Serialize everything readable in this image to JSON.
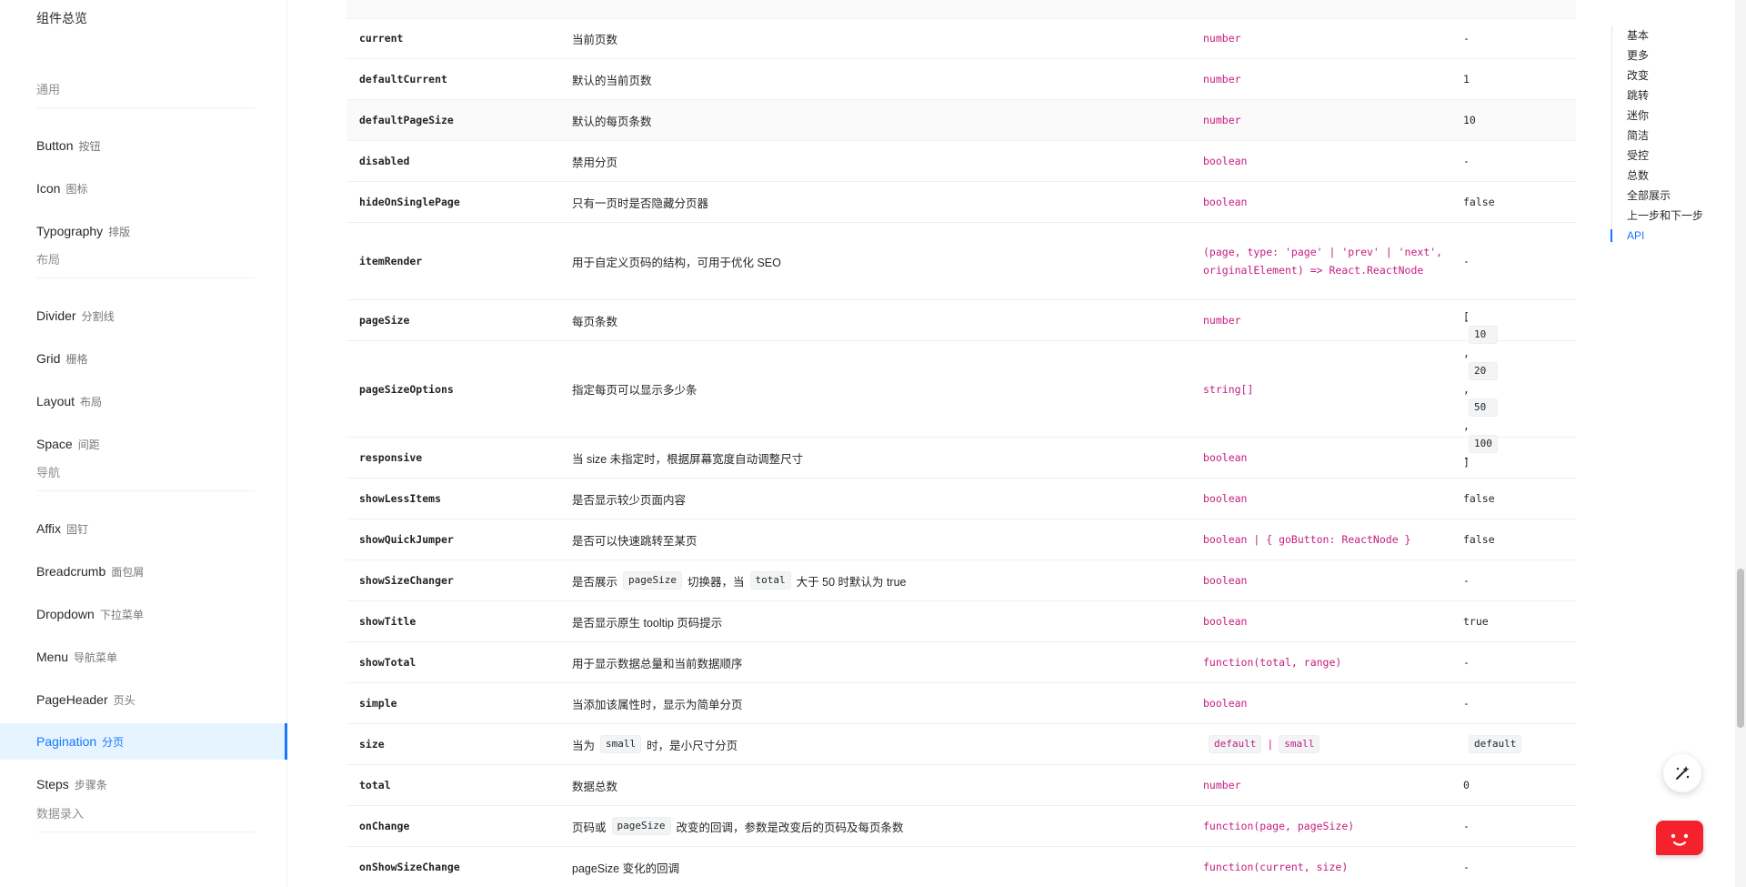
{
  "sidebar": {
    "top": "组件总览",
    "items": [
      {
        "type": "group",
        "label": "通用"
      },
      {
        "type": "item",
        "en": "Button",
        "zh": "按钮"
      },
      {
        "type": "item",
        "en": "Icon",
        "zh": "图标"
      },
      {
        "type": "item",
        "en": "Typography",
        "zh": "排版"
      },
      {
        "type": "group",
        "label": "布局"
      },
      {
        "type": "item",
        "en": "Divider",
        "zh": "分割线"
      },
      {
        "type": "item",
        "en": "Grid",
        "zh": "栅格"
      },
      {
        "type": "item",
        "en": "Layout",
        "zh": "布局"
      },
      {
        "type": "item",
        "en": "Space",
        "zh": "间距"
      },
      {
        "type": "group",
        "label": "导航"
      },
      {
        "type": "item",
        "en": "Affix",
        "zh": "固钉"
      },
      {
        "type": "item",
        "en": "Breadcrumb",
        "zh": "面包屑"
      },
      {
        "type": "item",
        "en": "Dropdown",
        "zh": "下拉菜单"
      },
      {
        "type": "item",
        "en": "Menu",
        "zh": "导航菜单"
      },
      {
        "type": "item",
        "en": "PageHeader",
        "zh": "页头"
      },
      {
        "type": "item",
        "en": "Pagination",
        "zh": "分页",
        "active": true
      },
      {
        "type": "item",
        "en": "Steps",
        "zh": "步骤条"
      },
      {
        "type": "group",
        "label": "数据录入"
      }
    ]
  },
  "table": {
    "rows": [
      {
        "prop": "current",
        "desc": [
          {
            "t": "当前页数"
          }
        ],
        "type": [
          {
            "t": "number"
          }
        ],
        "def": [
          {
            "t": "-"
          }
        ]
      },
      {
        "prop": "defaultCurrent",
        "desc": [
          {
            "t": "默认的当前页数"
          }
        ],
        "type": [
          {
            "t": "number"
          }
        ],
        "def": [
          {
            "t": "1"
          }
        ]
      },
      {
        "prop": "defaultPageSize",
        "desc": [
          {
            "t": "默认的每页条数"
          }
        ],
        "type": [
          {
            "t": "number"
          }
        ],
        "def": [
          {
            "t": "10"
          }
        ]
      },
      {
        "prop": "disabled",
        "desc": [
          {
            "t": "禁用分页"
          }
        ],
        "type": [
          {
            "t": "boolean"
          }
        ],
        "def": [
          {
            "t": "-"
          }
        ]
      },
      {
        "prop": "hideOnSinglePage",
        "desc": [
          {
            "t": "只有一页时是否隐藏分页器"
          }
        ],
        "type": [
          {
            "t": "boolean"
          }
        ],
        "def": [
          {
            "t": "false"
          }
        ]
      },
      {
        "prop": "itemRender",
        "desc": [
          {
            "t": "用于自定义页码的结构，可用于优化 SEO"
          }
        ],
        "type": [
          {
            "t": "(page, type: 'page' | 'prev' | 'next', originalElement) => React.ReactNode"
          }
        ],
        "def": [
          {
            "t": "-"
          }
        ]
      },
      {
        "prop": "pageSize",
        "desc": [
          {
            "t": "每页条数"
          }
        ],
        "type": [
          {
            "t": "number"
          }
        ],
        "def": [
          {
            "t": "-"
          }
        ]
      },
      {
        "prop": "pageSizeOptions",
        "desc": [
          {
            "t": "指定每页可以显示多少条"
          }
        ],
        "type": [
          {
            "t": "string[]"
          }
        ],
        "def": [
          {
            "t": "["
          },
          {
            "c": "10"
          },
          {
            "t": ","
          },
          {
            "c": "20"
          },
          {
            "t": ","
          },
          {
            "c": "50"
          },
          {
            "t": ","
          },
          {
            "c": "100"
          },
          {
            "t": "]"
          }
        ]
      },
      {
        "prop": "responsive",
        "desc": [
          {
            "t": "当 size 未指定时，根据屏幕宽度自动调整尺寸"
          }
        ],
        "type": [
          {
            "t": "boolean"
          }
        ],
        "def": [
          {
            "t": "-"
          }
        ]
      },
      {
        "prop": "showLessItems",
        "desc": [
          {
            "t": "是否显示较少页面内容"
          }
        ],
        "type": [
          {
            "t": "boolean"
          }
        ],
        "def": [
          {
            "t": "false"
          }
        ]
      },
      {
        "prop": "showQuickJumper",
        "desc": [
          {
            "t": "是否可以快速跳转至某页"
          }
        ],
        "type": [
          {
            "t": "boolean | { goButton: ReactNode }"
          }
        ],
        "def": [
          {
            "t": "false"
          }
        ]
      },
      {
        "prop": "showSizeChanger",
        "desc": [
          {
            "t": "是否展示"
          },
          {
            "c": "pageSize"
          },
          {
            "t": "切换器，当"
          },
          {
            "c": "total"
          },
          {
            "t": "大于 50 时默认为 true"
          }
        ],
        "type": [
          {
            "t": "boolean"
          }
        ],
        "def": [
          {
            "t": "-"
          }
        ]
      },
      {
        "prop": "showTitle",
        "desc": [
          {
            "t": "是否显示原生 tooltip 页码提示"
          }
        ],
        "type": [
          {
            "t": "boolean"
          }
        ],
        "def": [
          {
            "t": "true"
          }
        ]
      },
      {
        "prop": "showTotal",
        "desc": [
          {
            "t": "用于显示数据总量和当前数据顺序"
          }
        ],
        "type": [
          {
            "t": "function(total, range)"
          }
        ],
        "def": [
          {
            "t": "-"
          }
        ]
      },
      {
        "prop": "simple",
        "desc": [
          {
            "t": "当添加该属性时，显示为简单分页"
          }
        ],
        "type": [
          {
            "t": "boolean"
          }
        ],
        "def": [
          {
            "t": "-"
          }
        ]
      },
      {
        "prop": "size",
        "desc": [
          {
            "t": "当为"
          },
          {
            "c": "small"
          },
          {
            "t": "时，是小尺寸分页"
          }
        ],
        "type": [
          {
            "c": "default"
          },
          {
            "t": "|"
          },
          {
            "c": "small"
          }
        ],
        "def": [
          {
            "c": "default"
          }
        ]
      },
      {
        "prop": "total",
        "desc": [
          {
            "t": "数据总数"
          }
        ],
        "type": [
          {
            "t": "number"
          }
        ],
        "def": [
          {
            "t": "0"
          }
        ]
      },
      {
        "prop": "onChange",
        "desc": [
          {
            "t": "页码或"
          },
          {
            "c": "pageSize"
          },
          {
            "t": "改变的回调，参数是改变后的页码及每页条数"
          }
        ],
        "type": [
          {
            "t": "function(page, pageSize)"
          }
        ],
        "def": [
          {
            "t": "-"
          }
        ]
      },
      {
        "prop": "onShowSizeChange",
        "desc": [
          {
            "t": "pageSize 变化的回调"
          }
        ],
        "type": [
          {
            "t": "function(current, size)"
          }
        ],
        "def": [
          {
            "t": "-"
          }
        ]
      }
    ]
  },
  "anchor": {
    "items": [
      "基本",
      "更多",
      "改变",
      "跳转",
      "迷你",
      "简洁",
      "受控",
      "总数",
      "全部展示",
      "上一步和下一步",
      "API"
    ],
    "active": "API"
  },
  "icons": {
    "magic": "magic-wand-icon",
    "chat": "chat-face-icon"
  },
  "colors": {
    "accent": "#1677ff",
    "type_text": "#c41d7f",
    "chat_button": "#f5222d"
  }
}
